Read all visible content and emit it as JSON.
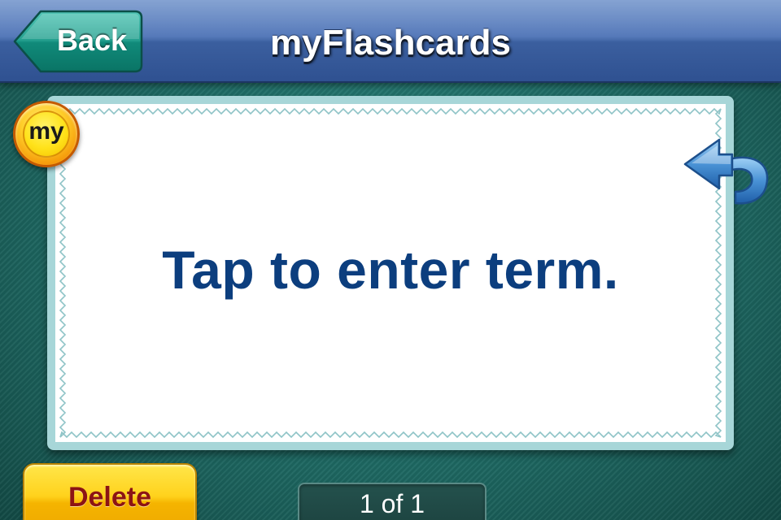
{
  "nav": {
    "back_label": "Back",
    "title": "myFlashcards"
  },
  "card": {
    "badge_text": "my",
    "term_placeholder": "Tap to enter term.",
    "flip_icon": "flip-card-arrow-icon"
  },
  "footer": {
    "delete_label": "Delete",
    "page_indicator": "1 of 1"
  },
  "colors": {
    "navbar": "#4f74b7",
    "background": "#1f6e68",
    "card_border": "#a7d6d8",
    "term_text": "#0c3e7e",
    "delete_button": "#ffd21c",
    "delete_text": "#8c1414",
    "badge": "#ffcf2a"
  }
}
